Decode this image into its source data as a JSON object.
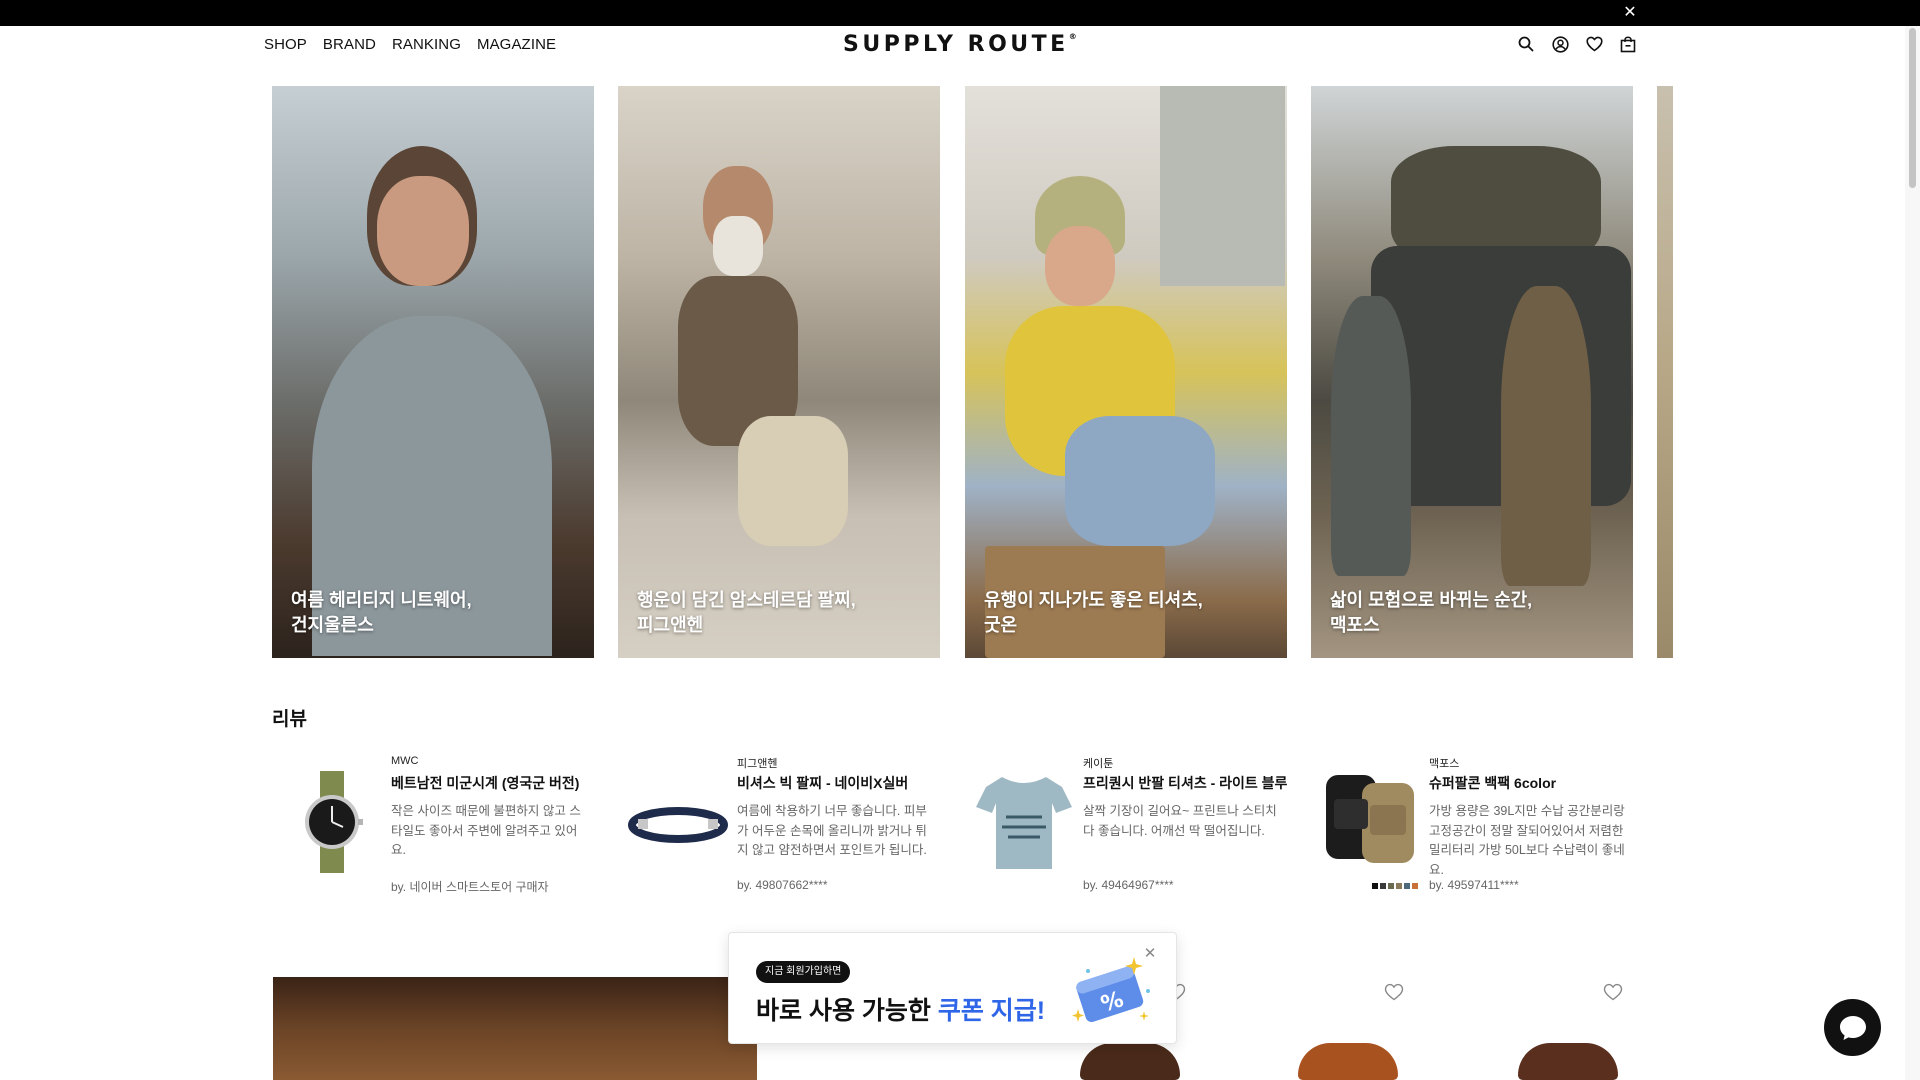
{
  "topbar": {
    "close_glyph": "✕"
  },
  "nav": {
    "items": [
      "SHOP",
      "BRAND",
      "RANKING",
      "MAGAZINE"
    ]
  },
  "logo": {
    "text": "SUPPLY ROUTE",
    "mark": "®"
  },
  "header_icons": [
    "search-icon",
    "account-icon",
    "wishlist-heart-icon",
    "shopping-bag-icon"
  ],
  "carousel": {
    "cards": [
      {
        "line1": "여름 헤리티지 니트웨어,",
        "line2": "건지울른스"
      },
      {
        "line1": "행운이 담긴 암스테르담 팔찌,",
        "line2": "피그앤헨"
      },
      {
        "line1": "유행이 지나가도 좋은 티셔츠,",
        "line2": "굿온"
      },
      {
        "line1": "삶이 모험으로 바뀌는 순간,",
        "line2": "맥포스"
      }
    ]
  },
  "reviews": {
    "title": "리뷰",
    "items": [
      {
        "brand": "MWC",
        "product": "베트남전 미군시계 (영국군 버전)",
        "text": "작은 사이즈 때문에 불편하지 않고 스타일도 좋아서 주변에 알려주고 있어요.",
        "by": "by. 네이버 스마트스토어 구매자"
      },
      {
        "brand": "피그앤헨",
        "product": "비셔스 빅 팔찌 - 네이비X실버",
        "text": "여름에 착용하기 너무 좋습니다. 피부가 어두운 손목에 올리니까 밝거나 튀지 않고 얌전하면서 포인트가 됩니다.",
        "by": "by. 49807662****"
      },
      {
        "brand": "케이툰",
        "product": "프리퀀시 반팔 티셔츠 - 라이트 블루",
        "text": "살짝 기장이 길어요~ 프린트나 스티치 다 좋습니다. 어깨선 딱 떨어집니다.",
        "by": "by. 49464967****"
      },
      {
        "brand": "맥포스",
        "product": "슈퍼팔콘 백팩 6color",
        "text": "가방 용량은 39L지만 수납 공간분리랑 고정공간이 정말 잘되어있어서 저렴한 밀리터리 가방 50L보다 수납력이 좋네요.",
        "by": "by. 49597411****"
      }
    ],
    "swatches": [
      "#111111",
      "#3b3b3b",
      "#6b6b4f",
      "#8a7b5a",
      "#4e6a7a",
      "#c8723a"
    ]
  },
  "popup": {
    "badge": "지금 회원가입하면",
    "title_plain": "바로 사용 가능한 ",
    "title_accent": "쿠폰 지급!",
    "close_glyph": "✕",
    "accent_color": "#2f66e8"
  },
  "colors": {
    "topbar": "#000000",
    "text": "#111111",
    "muted": "#666666"
  }
}
